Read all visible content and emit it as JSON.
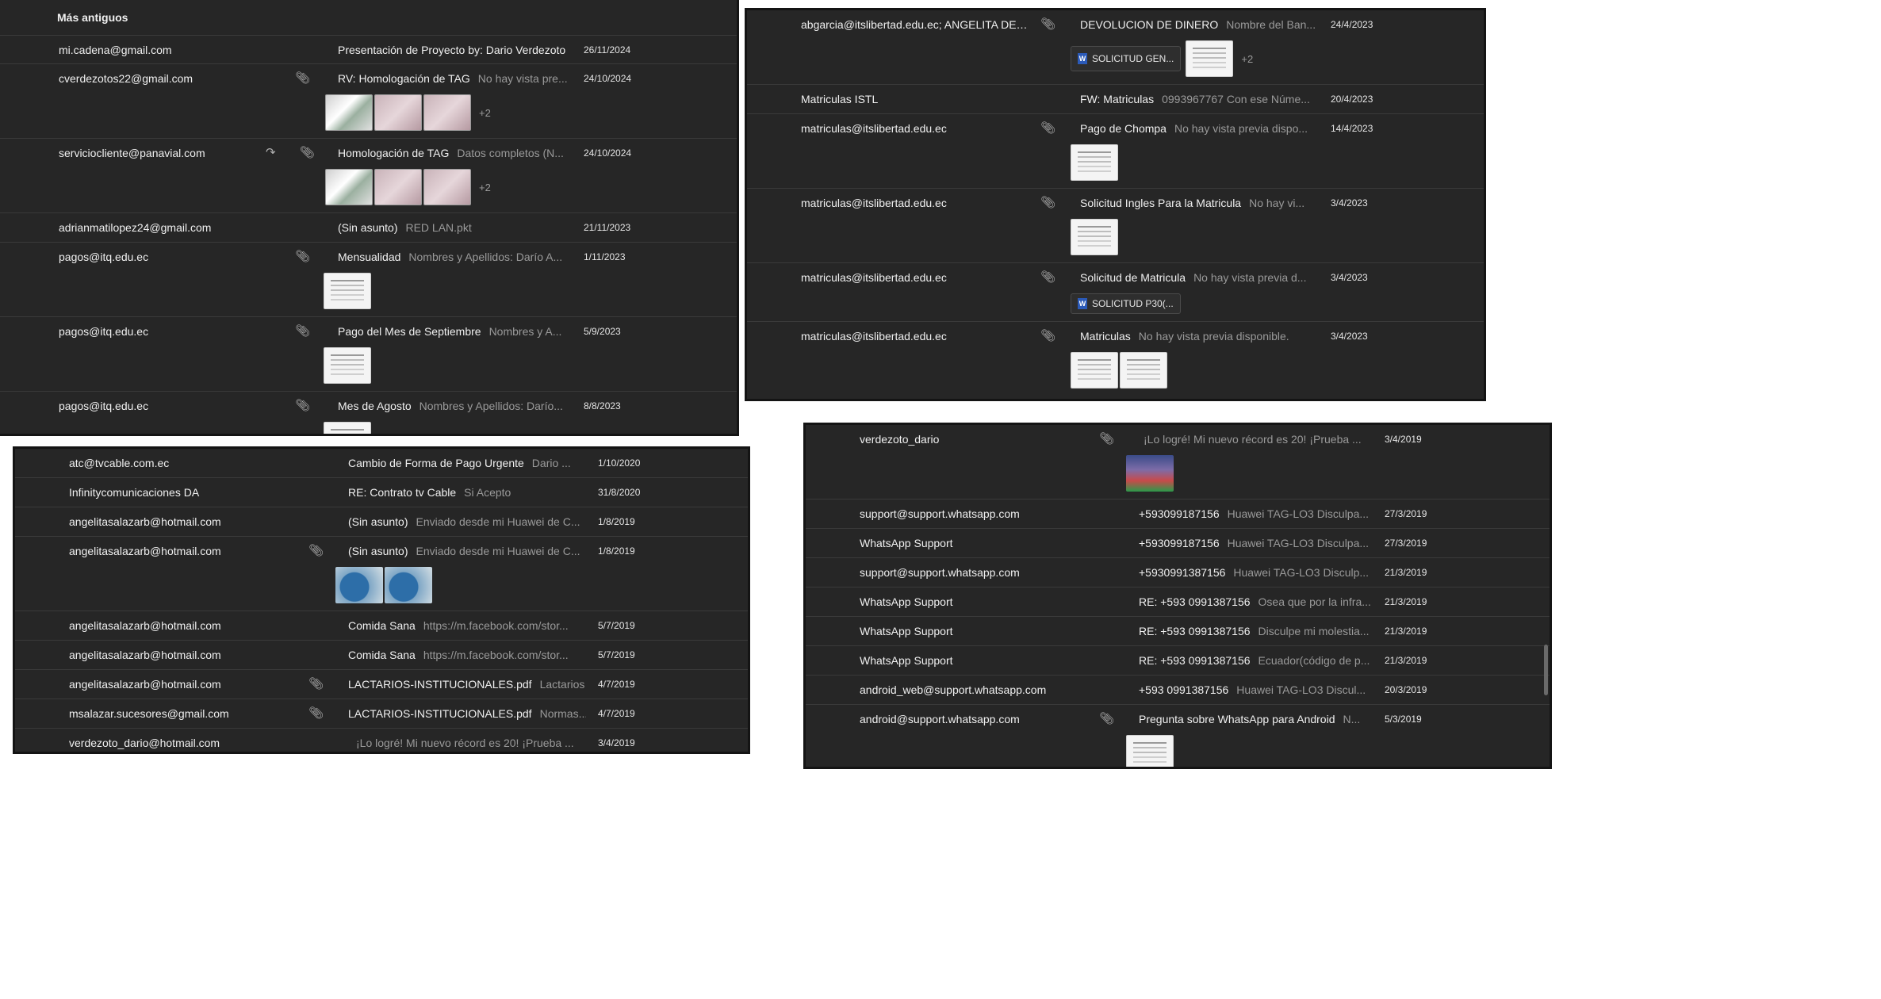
{
  "panel1": {
    "header": "Más antiguos",
    "rows": [
      {
        "sender": "mi.cadena@gmail.com",
        "subject": "Presentación de Proyecto by: Dario Verdezoto",
        "preview": "",
        "date": "26/11/2024"
      },
      {
        "sender": "cverdezotos22@gmail.com",
        "subject": "RV: Homologación de TAG",
        "preview": "No hay vista pre...",
        "date": "24/10/2024",
        "more": "+2"
      },
      {
        "sender": "serviciocliente@panavial.com",
        "subject": "Homologación de TAG",
        "preview": "Datos completos (N...",
        "date": "24/10/2024",
        "more": "+2"
      },
      {
        "sender": "adrianmatilopez24@gmail.com",
        "subject": "(Sin asunto)",
        "preview": "RED LAN.pkt",
        "date": "21/11/2023"
      },
      {
        "sender": "pagos@itq.edu.ec",
        "subject": "Mensualidad",
        "preview": "Nombres y Apellidos: Darío A...",
        "date": "1/11/2023"
      },
      {
        "sender": "pagos@itq.edu.ec",
        "subject": "Pago del Mes de Septiembre",
        "preview": "Nombres y A...",
        "date": "5/9/2023"
      },
      {
        "sender": "pagos@itq.edu.ec",
        "subject": "Mes de Agosto",
        "preview": "Nombres y Apellidos: Darío...",
        "date": "8/8/2023"
      }
    ]
  },
  "panel2": {
    "rows": [
      {
        "sender": "abgarcia@itslibertad.edu.ec; ANGELITA DEL ...",
        "subject": "DEVOLUCION DE DINERO",
        "preview": "Nombre del Ban...",
        "date": "24/4/2023",
        "chip": "SOLICITUD GEN...",
        "more": "+2"
      },
      {
        "sender": "Matriculas ISTL",
        "subject": "FW: Matriculas",
        "preview": "0993967767 Con ese Núme...",
        "date": "20/4/2023"
      },
      {
        "sender": "matriculas@itslibertad.edu.ec",
        "subject": "Pago de Chompa",
        "preview": "No hay vista previa dispo...",
        "date": "14/4/2023"
      },
      {
        "sender": "matriculas@itslibertad.edu.ec",
        "subject": "Solicitud Ingles Para la Matricula",
        "preview": "No hay vi...",
        "date": "3/4/2023"
      },
      {
        "sender": "matriculas@itslibertad.edu.ec",
        "subject": "Solicitud de Matricula",
        "preview": "No hay vista previa d...",
        "date": "3/4/2023",
        "chip": "SOLICITUD P30(..."
      },
      {
        "sender": "matriculas@itslibertad.edu.ec",
        "subject": "Matriculas",
        "preview": "No hay vista previa disponible.",
        "date": "3/4/2023"
      }
    ]
  },
  "panel3": {
    "rows": [
      {
        "sender": "atc@tvcable.com.ec",
        "subject": "Cambio de Forma de Pago Urgente",
        "preview": "Dario ...",
        "date": "1/10/2020"
      },
      {
        "sender": "Infinitycomunicaciones DA",
        "subject": "RE: Contrato tv Cable",
        "preview": "Si Acepto",
        "date": "31/8/2020"
      },
      {
        "sender": "angelitasalazarb@hotmail.com",
        "subject": "(Sin asunto)",
        "preview": "Enviado desde mi Huawei de C...",
        "date": "1/8/2019"
      },
      {
        "sender": "angelitasalazarb@hotmail.com",
        "subject": "(Sin asunto)",
        "preview": "Enviado desde mi Huawei de C...",
        "date": "1/8/2019"
      },
      {
        "sender": "angelitasalazarb@hotmail.com",
        "subject": "Comida Sana",
        "preview": "https://m.facebook.com/stor...",
        "date": "5/7/2019"
      },
      {
        "sender": "angelitasalazarb@hotmail.com",
        "subject": "Comida Sana",
        "preview": "https://m.facebook.com/stor...",
        "date": "5/7/2019"
      },
      {
        "sender": "angelitasalazarb@hotmail.com",
        "subject": "LACTARIOS-INSTITUCIONALES.pdf",
        "preview": "Lactarios",
        "date": "4/7/2019"
      },
      {
        "sender": "msalazar.sucesores@gmail.com",
        "subject": "LACTARIOS-INSTITUCIONALES.pdf",
        "preview": "Normas...",
        "date": "4/7/2019"
      },
      {
        "sender": "verdezoto_dario@hotmail.com",
        "subject": "",
        "preview": "¡Lo logré! Mi nuevo récord es 20! ¡Prueba ...",
        "date": "3/4/2019"
      }
    ]
  },
  "panel4": {
    "rows": [
      {
        "sender": "verdezoto_dario",
        "subject": "",
        "preview": "¡Lo logré! Mi nuevo récord es 20! ¡Prueba ...",
        "date": "3/4/2019"
      },
      {
        "sender": "support@support.whatsapp.com",
        "subject": "+593099187156",
        "preview": "Huawei TAG-LO3 Disculpa...",
        "date": "27/3/2019"
      },
      {
        "sender": "WhatsApp Support",
        "subject": "+593099187156",
        "preview": "Huawei TAG-LO3 Disculpa...",
        "date": "27/3/2019"
      },
      {
        "sender": "support@support.whatsapp.com",
        "subject": "+5930991387156",
        "preview": "Huawei TAG-LO3 Disculp...",
        "date": "21/3/2019"
      },
      {
        "sender": "WhatsApp Support",
        "subject": "RE: +593 0991387156",
        "preview": "Osea que por la infra...",
        "date": "21/3/2019"
      },
      {
        "sender": "WhatsApp Support",
        "subject": "RE: +593 0991387156",
        "preview": "Disculpe mi molestia...",
        "date": "21/3/2019"
      },
      {
        "sender": "WhatsApp Support",
        "subject": "RE: +593 0991387156",
        "preview": "Ecuador(código de p...",
        "date": "21/3/2019"
      },
      {
        "sender": "android_web@support.whatsapp.com",
        "subject": "+593 0991387156",
        "preview": "Huawei TAG-LO3 Discul...",
        "date": "20/3/2019"
      },
      {
        "sender": "android@support.whatsapp.com",
        "subject": "Pregunta sobre WhatsApp para Android",
        "preview": "N...",
        "date": "5/3/2019"
      }
    ]
  }
}
